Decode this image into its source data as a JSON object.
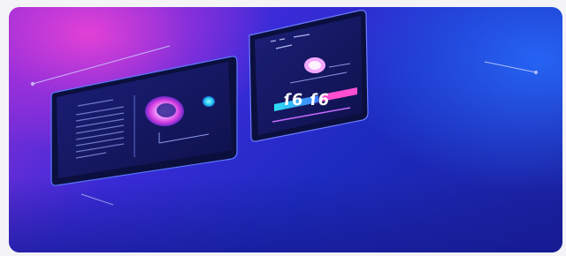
{
  "scene": {
    "description_free": true,
    "headline_text": "ſ6 ſ6",
    "colors": {
      "magenta": "#e93fd6",
      "violet": "#6a2be0",
      "blue": "#2033c8",
      "navy": "#10145a",
      "cyan": "#27d6f2",
      "pink": "#ff52c8"
    }
  }
}
